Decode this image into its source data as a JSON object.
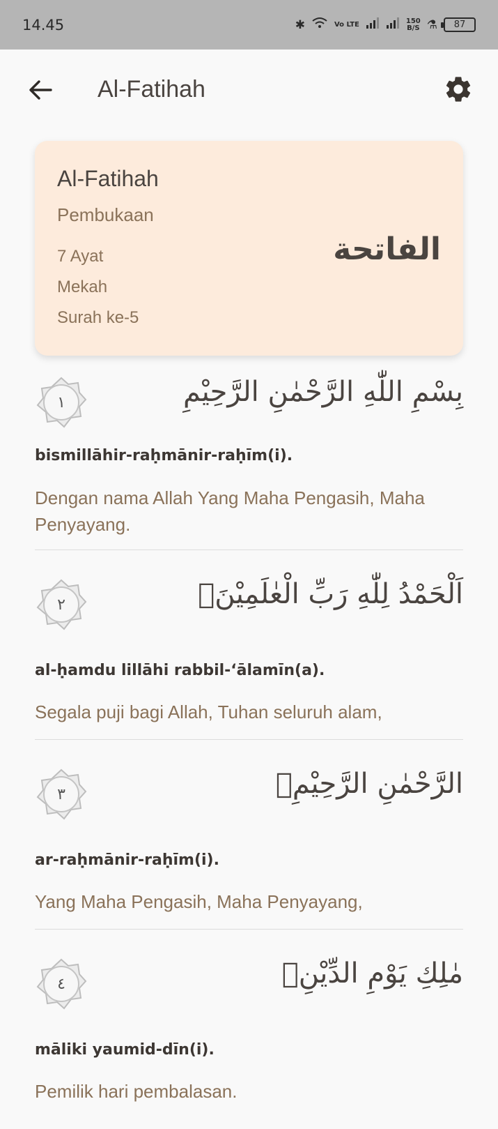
{
  "status": {
    "time": "14.45",
    "net_label": "Vo LTE",
    "speed_value": "150",
    "speed_unit": "B/S",
    "battery": "87"
  },
  "appbar": {
    "title": "Al-Fatihah"
  },
  "surah": {
    "latin_name": "Al-Fatihah",
    "meaning": "Pembukaan",
    "ayat_count": "7 Ayat",
    "place": "Mekah",
    "order": "Surah ke-5",
    "arabic_name": "الفاتحة"
  },
  "ayahs": [
    {
      "number": "١",
      "arabic": "بِسْمِ اللّٰهِ الرَّحْمٰنِ الرَّحِيْمِ",
      "transliteration": "bismillāhir-raḥmānir-raḥīm(i).",
      "translation": "Dengan nama Allah Yang Maha Pengasih, Maha Penyayang."
    },
    {
      "number": "٢",
      "arabic": "اَلْحَمْدُ لِلّٰهِ رَبِّ الْعٰلَمِيْنَۙ",
      "transliteration": "al-ḥamdu lillāhi rabbil-‘ālamīn(a).",
      "translation": "Segala puji bagi Allah, Tuhan seluruh alam,"
    },
    {
      "number": "٣",
      "arabic": "الرَّحْمٰنِ الرَّحِيْمِۙ",
      "transliteration": "ar-raḥmānir-raḥīm(i).",
      "translation": "Yang Maha Pengasih, Maha Penyayang,"
    },
    {
      "number": "٤",
      "arabic": "مٰلِكِ يَوْمِ الدِّيْنِۗ",
      "transliteration": "māliki yaumid-dīn(i).",
      "translation": "Pemilik hari pembalasan."
    }
  ]
}
